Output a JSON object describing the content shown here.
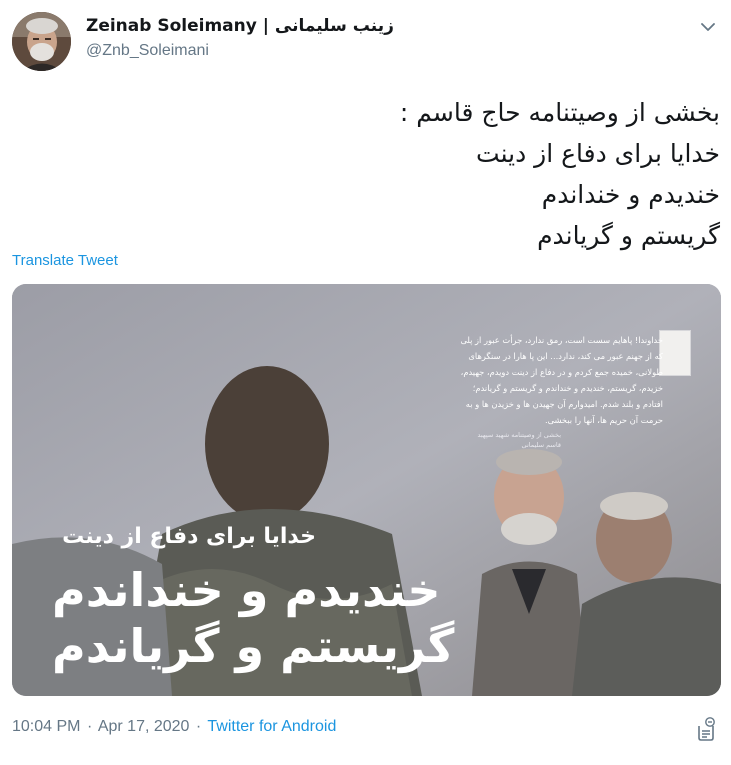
{
  "user": {
    "display_name": "Zeinab Soleimany | زینب سلیمانی",
    "handle": "@Znb_Soleimani",
    "avatar_icon": "profile-photo"
  },
  "tweet": {
    "lines": [
      "بخشی از وصیتنامه حاج قاسم :",
      "خدایا برای دفاع از دینت",
      "خندیدم و خنداندم",
      "گریستم و گریاندم"
    ],
    "translate_label": "Translate Tweet",
    "time": "10:04 PM",
    "date": "Apr 17, 2020",
    "source": "Twitter for Android"
  },
  "media": {
    "title_small": "خدایا برای دفاع از دینت",
    "title_line1": "خندیدم و خنداندم",
    "title_line2": "گریستم و گریاندم",
    "paragraph": "خداوندا! پاهایم سست است، رمق ندارد، جرأت عبور از پلی که از جهنم عبور می کند، ندارد... این پا هارا در سنگرهای طولانی، خمیده جمع کردم و در دفاع از دینت دویدم، جهیدم، خزیدم، گریستم، خندیدم و خنداندم و گریستم و گریاندم؛ افتادم و بلند شدم. امیدوارم آن جهیدن ها و خزیدن ها و به حرمت آن حریم ها، آنها را ببخشی.",
    "signature": "بخشی از وصیتنامه شهید سپهبد قاسم سلیمانی"
  },
  "colors": {
    "link": "#1b95e0",
    "secondary": "#657786",
    "text": "#14171a"
  }
}
